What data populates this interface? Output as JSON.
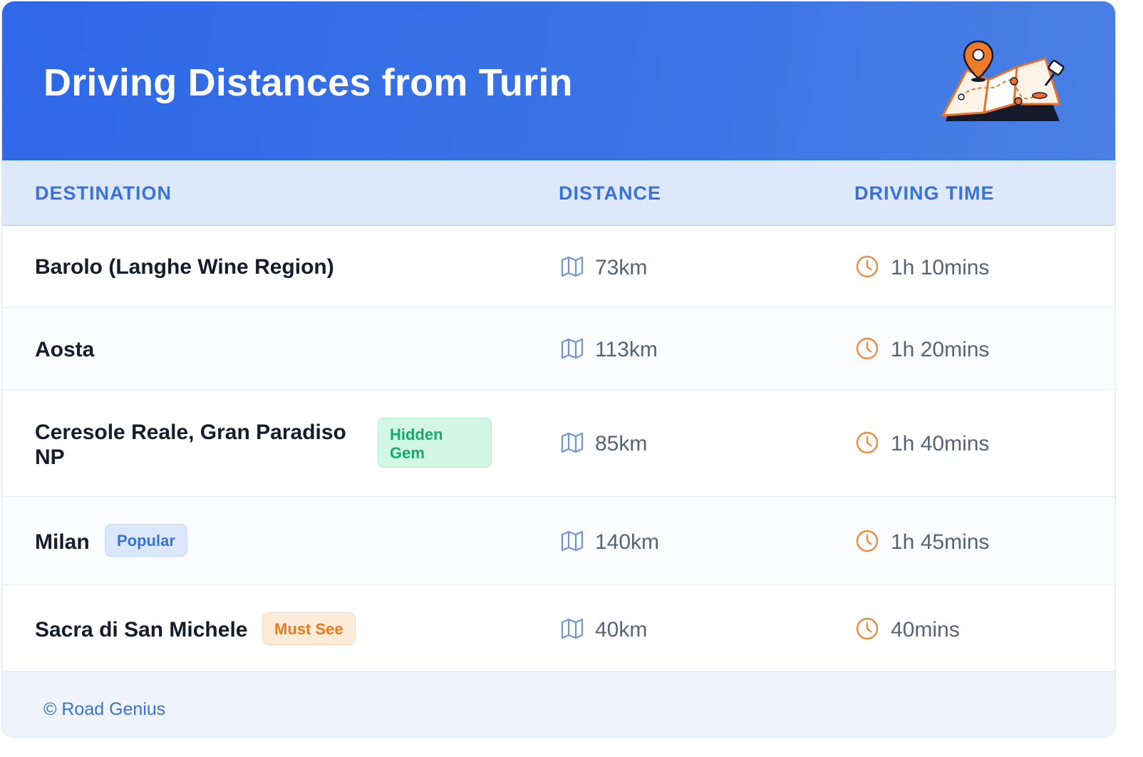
{
  "header": {
    "title": "Driving Distances from Turin",
    "illustration_icon": "folded-map-with-location-pin-icon",
    "gradient_colors": [
      "#2f68e8",
      "#4a80e4"
    ]
  },
  "table": {
    "columns": [
      "DESTINATION",
      "DISTANCE",
      "DRIVING TIME"
    ],
    "distance_icon": "map-icon",
    "time_icon": "clock-icon",
    "rows": [
      {
        "destination": "Barolo (Langhe Wine Region)",
        "badge": "",
        "distance": "73km",
        "time": "1h 10mins"
      },
      {
        "destination": "Aosta",
        "badge": "",
        "distance": "113km",
        "time": "1h 20mins"
      },
      {
        "destination": "Ceresole Reale, Gran Paradiso NP",
        "badge": "Hidden Gem",
        "distance": "85km",
        "time": "1h 40mins"
      },
      {
        "destination": "Milan",
        "badge": "Popular",
        "distance": "140km",
        "time": "1h 45mins"
      },
      {
        "destination": "Sacra di San Michele",
        "badge": "Must See",
        "distance": "40km",
        "time": "40mins"
      }
    ]
  },
  "footer": {
    "copyright": "© Road Genius"
  },
  "colors": {
    "accent": "#3a72d8",
    "clock": "#ef8a3e",
    "badge_green": "#17a86a",
    "badge_orange": "#ec7a18"
  }
}
